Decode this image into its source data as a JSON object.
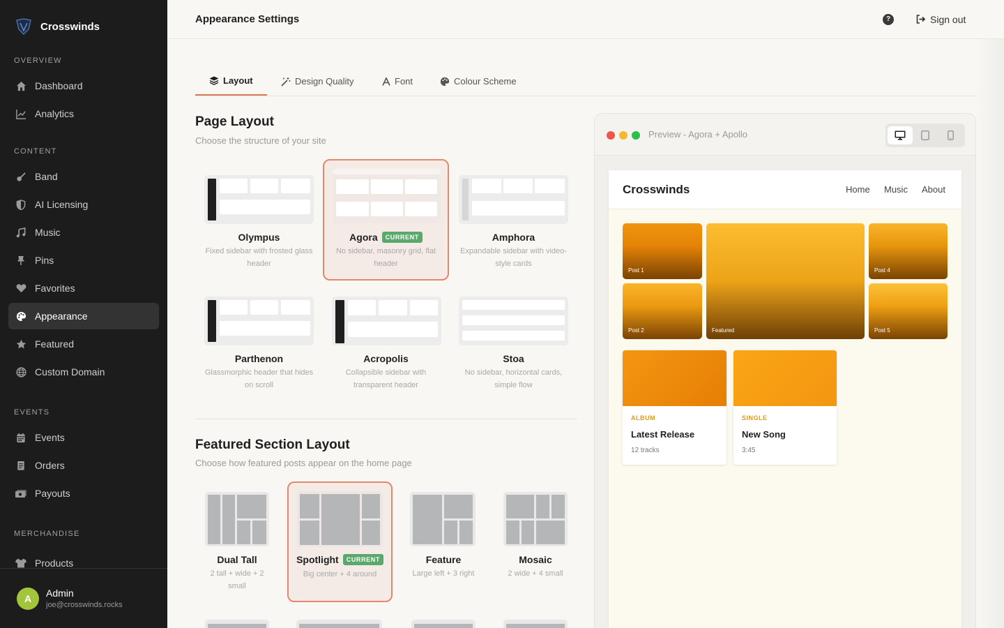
{
  "app": {
    "name": "Crosswinds"
  },
  "sidebar": {
    "sections": [
      {
        "label": "OVERVIEW",
        "items": [
          {
            "label": "Dashboard",
            "icon": "home-icon"
          },
          {
            "label": "Analytics",
            "icon": "chart-icon"
          }
        ]
      },
      {
        "label": "CONTENT",
        "items": [
          {
            "label": "Band",
            "icon": "guitar-icon"
          },
          {
            "label": "AI Licensing",
            "icon": "shield-icon"
          },
          {
            "label": "Music",
            "icon": "music-icon"
          },
          {
            "label": "Pins",
            "icon": "pin-icon"
          },
          {
            "label": "Favorites",
            "icon": "heart-icon"
          },
          {
            "label": "Appearance",
            "icon": "palette-icon"
          },
          {
            "label": "Featured",
            "icon": "star-icon"
          },
          {
            "label": "Custom Domain",
            "icon": "globe-icon"
          }
        ]
      },
      {
        "label": "EVENTS",
        "items": [
          {
            "label": "Events",
            "icon": "calendar-icon"
          },
          {
            "label": "Orders",
            "icon": "receipt-icon"
          },
          {
            "label": "Payouts",
            "icon": "money-icon"
          }
        ]
      },
      {
        "label": "MERCHANDISE",
        "items": [
          {
            "label": "Products",
            "icon": "shirt-icon"
          }
        ]
      }
    ],
    "active": "Appearance",
    "user": {
      "initial": "A",
      "name": "Admin",
      "email": "joe@crosswinds.rocks"
    }
  },
  "header": {
    "title": "Appearance Settings",
    "help": "?",
    "signout_label": "Sign out"
  },
  "tabs": [
    {
      "label": "Layout",
      "icon": "layers-icon",
      "active": true
    },
    {
      "label": "Design Quality",
      "icon": "wand-icon",
      "active": false
    },
    {
      "label": "Font",
      "icon": "font-icon",
      "active": false
    },
    {
      "label": "Colour Scheme",
      "icon": "palette-icon",
      "active": false
    }
  ],
  "page_layout": {
    "title": "Page Layout",
    "subtitle": "Choose the structure of your site",
    "current_badge": "CURRENT",
    "options": [
      {
        "name": "Olympus",
        "desc": "Fixed sidebar with frosted glass header",
        "current": false
      },
      {
        "name": "Agora",
        "desc": "No sidebar, masonry grid, flat header",
        "current": true
      },
      {
        "name": "Amphora",
        "desc": "Expandable sidebar with video-style cards",
        "current": false
      },
      {
        "name": "Parthenon",
        "desc": "Glassmorphic header that hides on scroll",
        "current": false
      },
      {
        "name": "Acropolis",
        "desc": "Collapsible sidebar with transparent header",
        "current": false
      },
      {
        "name": "Stoa",
        "desc": "No sidebar, horizontal cards, simple flow",
        "current": false
      }
    ]
  },
  "featured_layout": {
    "title": "Featured Section Layout",
    "subtitle": "Choose how featured posts appear on the home page",
    "options": [
      {
        "name": "Dual Tall",
        "desc": "2 tall + wide + 2 small",
        "current": false
      },
      {
        "name": "Spotlight",
        "desc": "Big center + 4 around",
        "current": true
      },
      {
        "name": "Feature",
        "desc": "Large left + 3 right",
        "current": false
      },
      {
        "name": "Mosaic",
        "desc": "2 wide + 4 small",
        "current": false
      }
    ]
  },
  "preview": {
    "title": "Preview - Agora + Apollo",
    "devices": [
      {
        "icon": "desktop-icon",
        "active": true
      },
      {
        "icon": "tablet-icon",
        "active": false
      },
      {
        "icon": "phone-icon",
        "active": false
      }
    ],
    "site": {
      "name": "Crosswinds",
      "nav": [
        "Home",
        "Music",
        "About"
      ],
      "tiles": [
        "Post 1",
        "Post 2",
        "Featured",
        "Post 4",
        "Post 5"
      ],
      "releases": [
        {
          "type": "ALBUM",
          "title": "Latest Release",
          "meta": "12 tracks"
        },
        {
          "type": "SINGLE",
          "title": "New Song",
          "meta": "3:45"
        }
      ]
    }
  },
  "colors": {
    "accent": "#e4876a",
    "selected_bg": "#f5ebe6",
    "badge": "#5aa86b",
    "sidebar_bg": "#1c1c1c"
  }
}
